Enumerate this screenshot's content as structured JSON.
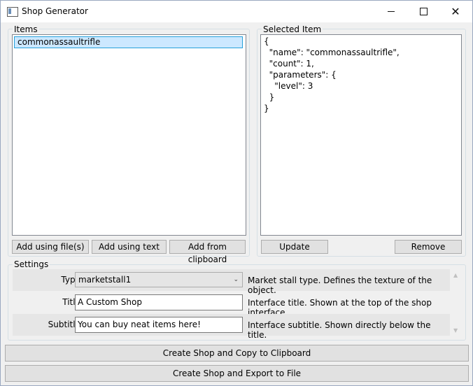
{
  "window": {
    "title": "Shop Generator",
    "icon": "app-window-icon"
  },
  "items_panel": {
    "label": "Items",
    "items": [
      "commonassaultrifle"
    ],
    "buttons": {
      "add_files": "Add using file(s)",
      "add_text": "Add using text",
      "add_clipboard": "Add from clipboard"
    }
  },
  "selected_panel": {
    "label": "Selected Item",
    "json_lines": [
      "{",
      "  \"name\": \"commonassaultrifle\",",
      "  \"count\": 1,",
      "  \"parameters\": {",
      "    \"level\": 3",
      "  }",
      "}"
    ],
    "buttons": {
      "update": "Update",
      "remove": "Remove"
    }
  },
  "settings": {
    "label": "Settings",
    "type": {
      "label": "Type:",
      "value": "marketstall1",
      "description": "Market stall type. Defines the texture of the object."
    },
    "title": {
      "label": "Title:",
      "value": "A Custom Shop",
      "description": "Interface title. Shown at the top of the shop interface."
    },
    "subtitle": {
      "label": "Subtitle:",
      "value": "You can buy neat items here!",
      "description": "Interface subtitle. Shown directly below the title."
    }
  },
  "actions": {
    "copy": "Create Shop and Copy to Clipboard",
    "export": "Create Shop and Export to File"
  }
}
